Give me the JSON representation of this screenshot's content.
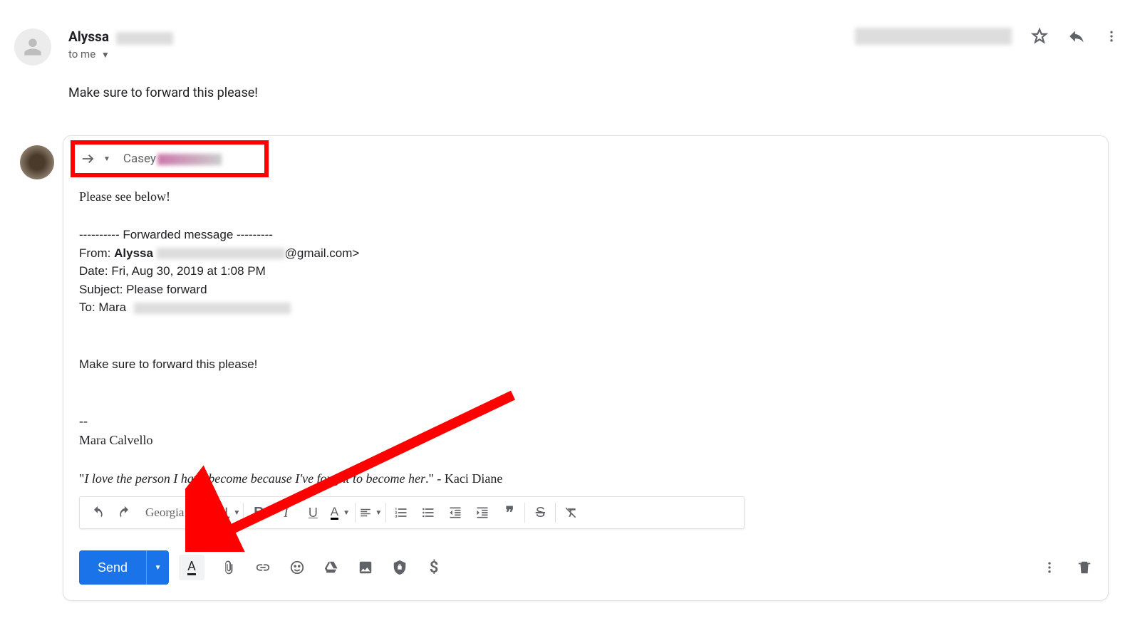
{
  "original_message": {
    "sender_name": "Alyssa",
    "to_line": "to me",
    "body": "Make sure to forward this please!"
  },
  "compose": {
    "recipient": "Casey",
    "body_intro": "Please see below!",
    "forward_header": "---------- Forwarded message ---------",
    "from_label": "From: ",
    "from_name": "Alyssa",
    "from_domain": "@gmail.com>",
    "date_line": "Date: Fri, Aug 30, 2019 at 1:08 PM",
    "subject_line": "Subject: Please forward",
    "to_label": "To: Mara",
    "forwarded_body": "Make sure to forward this please!",
    "sig_sep": "--",
    "sig_name": "Mara Calvello",
    "sig_quote_open": "\"",
    "sig_quote": "I love the person I have become because I've fought to become her",
    "sig_quote_close": ".\" - Kaci Diane"
  },
  "toolbar": {
    "font_family": "Georgia"
  },
  "actions": {
    "send": "Send"
  }
}
